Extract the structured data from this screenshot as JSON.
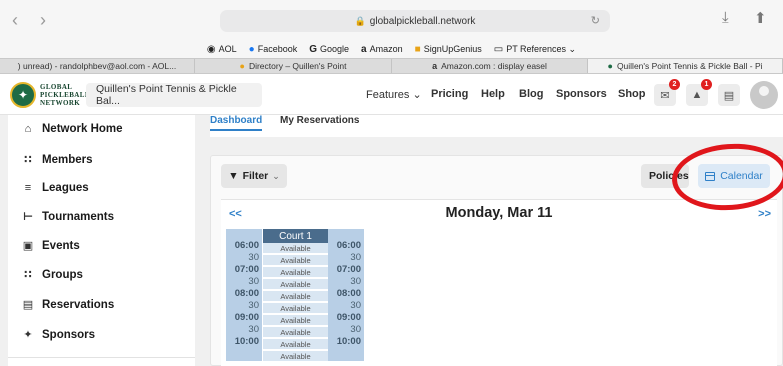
{
  "browser": {
    "url": "globalpickleball.network",
    "bookmarks": [
      {
        "label": "AOL",
        "icon": "aol-icon"
      },
      {
        "label": "Facebook",
        "icon": "facebook-icon"
      },
      {
        "label": "Google",
        "icon": "google-icon"
      },
      {
        "label": "Amazon",
        "icon": "amazon-icon"
      },
      {
        "label": "SignUpGenius",
        "icon": "signupgenius-icon"
      },
      {
        "label": "PT References ⌄",
        "icon": "folder-icon"
      }
    ],
    "tabs": [
      {
        "label": ") unread) - randolphbev@aol.com - AOL..."
      },
      {
        "label": "Directory – Quillen's Point"
      },
      {
        "label": "Amazon.com : display easel"
      },
      {
        "label": "Quillen's Point Tennis & Pickle Ball - Pi"
      }
    ]
  },
  "header": {
    "logo_text": [
      "GLOBAL",
      "PICKLEBALL",
      "NETWORK"
    ],
    "club_name": "Quillen's Point Tennis & Pickle Bal...",
    "nav": [
      "Features ⌄",
      "Pricing",
      "Help",
      "Blog",
      "Sponsors",
      "Shop"
    ],
    "mail_badge": "2",
    "bell_badge": "1"
  },
  "sidebar": {
    "items": [
      {
        "label": "Network Home",
        "icon": "home-icon"
      },
      {
        "label": "Members",
        "icon": "members-icon"
      },
      {
        "label": "Leagues",
        "icon": "list-icon"
      },
      {
        "label": "Tournaments",
        "icon": "bracket-icon"
      },
      {
        "label": "Events",
        "icon": "calendar-icon"
      },
      {
        "label": "Groups",
        "icon": "groups-icon"
      },
      {
        "label": "Reservations",
        "icon": "reservations-icon"
      },
      {
        "label": "Sponsors",
        "icon": "sparkle-icon"
      }
    ]
  },
  "main": {
    "tabs": {
      "dashboard": "Dashboard",
      "reservations": "My Reservations"
    },
    "filter_label": "Filter",
    "policies_label": "Policies",
    "calendar_label": "Calendar",
    "prev": "<<",
    "next": ">>",
    "date": "Monday, Mar 11",
    "court": "Court 1",
    "times": [
      "06:00",
      "30",
      "07:00",
      "30",
      "08:00",
      "30",
      "09:00",
      "30",
      "10:00"
    ],
    "slots": [
      "Available",
      "Available",
      "Available",
      "Available",
      "Available",
      "Available",
      "Available",
      "Available",
      "Available",
      "Available",
      "Available"
    ]
  },
  "colors": {
    "accent": "#2f80c8",
    "annotation": "#e0161b",
    "brand": "#1e6b45"
  }
}
